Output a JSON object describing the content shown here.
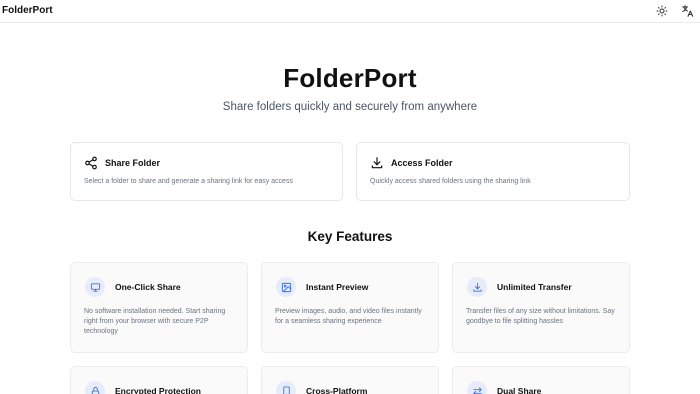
{
  "header": {
    "brand": "FolderPort",
    "icons": [
      "sun-icon",
      "translate-icon"
    ]
  },
  "hero": {
    "title": "FolderPort",
    "subtitle": "Share folders quickly and securely from anywhere"
  },
  "actions": [
    {
      "title": "Share Folder",
      "description": "Select a folder to share and generate a sharing link for easy access",
      "icon": "share-icon"
    },
    {
      "title": "Access Folder",
      "description": "Quickly access shared folders using the sharing link",
      "icon": "download-icon"
    }
  ],
  "features_section": {
    "title": "Key Features",
    "items": [
      {
        "title": "One-Click Share",
        "description": "No software installation needed. Start sharing right from your browser with secure P2P technology",
        "icon": "monitor-icon"
      },
      {
        "title": "Instant Preview",
        "description": "Preview images, audio, and video files instantly for a seamless sharing experience",
        "icon": "image-icon"
      },
      {
        "title": "Unlimited Transfer",
        "description": "Transfer files of any size without limitations. Say goodbye to file splitting hassles",
        "icon": "download-icon"
      },
      {
        "title": "Encrypted Protection",
        "description": "",
        "icon": "lock-icon"
      },
      {
        "title": "Cross-Platform",
        "description": "",
        "icon": "smartphone-icon"
      },
      {
        "title": "Dual Share",
        "description": "",
        "icon": "arrows-exchange-icon"
      }
    ]
  },
  "colors": {
    "icon_accent": "#3b6ff0",
    "icon_bg": "#e7ecfb",
    "text_primary": "#111111",
    "text_muted": "#6b7280",
    "border": "#e5e7eb"
  }
}
